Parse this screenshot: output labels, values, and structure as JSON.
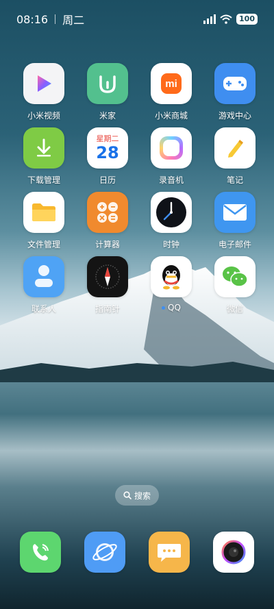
{
  "status": {
    "time": "08:16",
    "weekday": "周二",
    "battery": "100"
  },
  "apps": [
    {
      "label": "小米视频",
      "icon": "play-icon"
    },
    {
      "label": "米家",
      "icon": "mijia-icon"
    },
    {
      "label": "小米商城",
      "icon": "mi-store-icon"
    },
    {
      "label": "游戏中心",
      "icon": "gamepad-icon"
    },
    {
      "label": "下载管理",
      "icon": "download-icon"
    },
    {
      "label": "日历",
      "icon": "calendar-icon",
      "calendar_weekday": "星期二",
      "calendar_day": "28"
    },
    {
      "label": "录音机",
      "icon": "recorder-icon"
    },
    {
      "label": "笔记",
      "icon": "notes-icon"
    },
    {
      "label": "文件管理",
      "icon": "folder-icon"
    },
    {
      "label": "计算器",
      "icon": "calculator-icon"
    },
    {
      "label": "时钟",
      "icon": "clock-icon"
    },
    {
      "label": "电子邮件",
      "icon": "mail-icon"
    },
    {
      "label": "联系人",
      "icon": "contacts-icon"
    },
    {
      "label": "指南针",
      "icon": "compass-icon"
    },
    {
      "label": "QQ",
      "icon": "qq-icon"
    },
    {
      "label": "微信",
      "icon": "wechat-icon"
    }
  ],
  "search": {
    "label": "搜索"
  },
  "dock": [
    {
      "icon": "phone-icon"
    },
    {
      "icon": "browser-icon"
    },
    {
      "icon": "messages-icon"
    },
    {
      "icon": "camera-icon"
    }
  ]
}
